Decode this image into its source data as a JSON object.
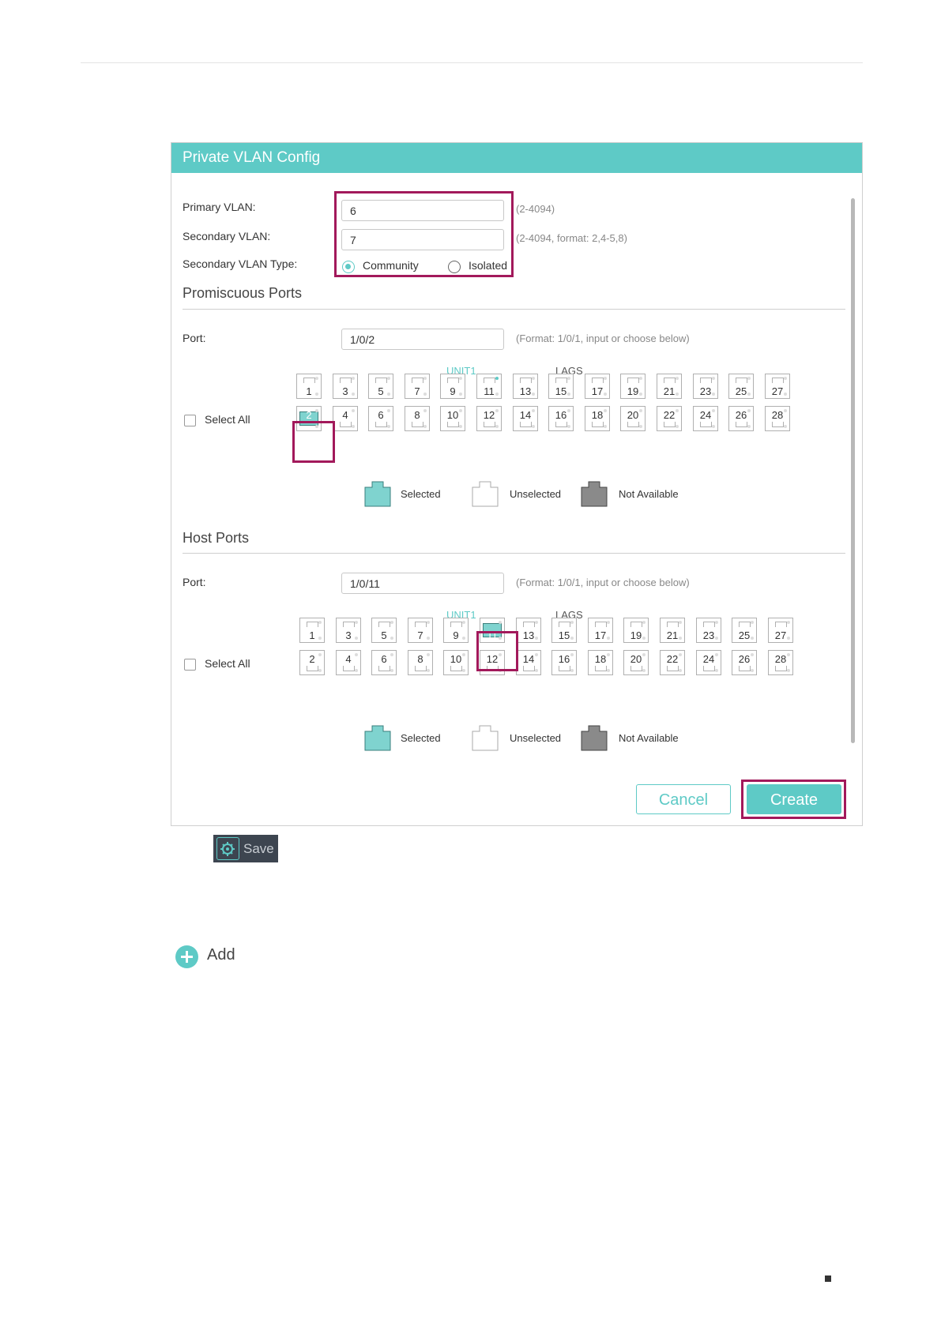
{
  "panel": {
    "title": "Private VLAN Config"
  },
  "form": {
    "primary_vlan_label": "Primary VLAN:",
    "primary_vlan_value": "6",
    "primary_vlan_hint": "(2-4094)",
    "secondary_vlan_label": "Secondary VLAN:",
    "secondary_vlan_value": "7",
    "secondary_vlan_hint": "(2-4094, format: 2,4-5,8)",
    "type_label": "Secondary VLAN Type:",
    "type_options": [
      "Community",
      "Isolated"
    ],
    "type_selected": "Community"
  },
  "promiscuous": {
    "title": "Promiscuous Ports",
    "port_label": "Port:",
    "port_value": "1/0/2",
    "port_hint": "(Format: 1/0/1, input or choose below)",
    "unit_label": "UNIT1",
    "lags_label": "LAGS",
    "select_all_label": "Select All",
    "top_ports": [
      "1",
      "3",
      "5",
      "7",
      "9",
      "11",
      "13",
      "15",
      "17",
      "19",
      "21",
      "23",
      "25",
      "27"
    ],
    "bottom_ports": [
      "2",
      "4",
      "6",
      "8",
      "10",
      "12",
      "14",
      "16",
      "18",
      "20",
      "22",
      "24",
      "26",
      "28"
    ],
    "selected_ports": [
      "2"
    ],
    "active_led_ports": [
      "11"
    ]
  },
  "host": {
    "title": "Host Ports",
    "port_label": "Port:",
    "port_value": "1/0/11",
    "port_hint": "(Format: 1/0/1, input or choose below)",
    "unit_label": "UNIT1",
    "lags_label": "LAGS",
    "select_all_label": "Select All",
    "top_ports": [
      "1",
      "3",
      "5",
      "7",
      "9",
      "11",
      "13",
      "15",
      "17",
      "19",
      "21",
      "23",
      "25",
      "27"
    ],
    "bottom_ports": [
      "2",
      "4",
      "6",
      "8",
      "10",
      "12",
      "14",
      "16",
      "18",
      "20",
      "22",
      "24",
      "26",
      "28"
    ],
    "selected_ports": [
      "11"
    ],
    "active_led_ports": []
  },
  "legend": {
    "selected": "Selected",
    "unselected": "Unselected",
    "not_available": "Not Available"
  },
  "buttons": {
    "cancel": "Cancel",
    "create": "Create"
  },
  "toolbar": {
    "save_label": "Save"
  },
  "actions": {
    "add_label": "Add"
  },
  "colors": {
    "accent": "#5ecac6",
    "highlight": "#a2195b",
    "unavailable": "#8a8a8a"
  },
  "icons": {
    "save": "gear-icon",
    "add": "plus-circle-icon"
  }
}
